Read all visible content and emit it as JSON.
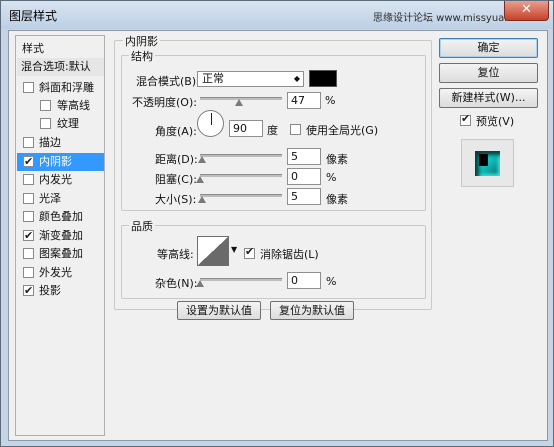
{
  "window": {
    "title": "图层样式",
    "watermark": "思缘设计论坛 www.missyuan.com",
    "close_glyph": "✕"
  },
  "stylelist": {
    "header": "样式",
    "default_item": "混合选项:默认",
    "items": [
      {
        "label": "斜面和浮雕",
        "checked": false
      },
      {
        "label": "等高线",
        "checked": false
      },
      {
        "label": "纹理",
        "checked": false
      },
      {
        "label": "描边",
        "checked": false
      },
      {
        "label": "内阴影",
        "checked": true,
        "selected": true
      },
      {
        "label": "内发光",
        "checked": false
      },
      {
        "label": "光泽",
        "checked": false
      },
      {
        "label": "颜色叠加",
        "checked": false
      },
      {
        "label": "渐变叠加",
        "checked": true
      },
      {
        "label": "图案叠加",
        "checked": false
      },
      {
        "label": "外发光",
        "checked": false
      },
      {
        "label": "投影",
        "checked": true
      }
    ]
  },
  "inner_shadow": {
    "title": "内阴影",
    "structure": {
      "title": "结构",
      "blend_mode_label": "混合模式(B):",
      "blend_mode_value": "正常",
      "blend_color": "#000000",
      "opacity_label": "不透明度(O):",
      "opacity_value": "47",
      "opacity_unit": "%",
      "angle_label": "角度(A):",
      "angle_value": "90",
      "angle_unit": "度",
      "global_light_label": "使用全局光(G)",
      "global_light_checked": false,
      "distance_label": "距离(D):",
      "distance_value": "5",
      "distance_unit": "像素",
      "choke_label": "阻塞(C):",
      "choke_value": "0",
      "choke_unit": "%",
      "size_label": "大小(S):",
      "size_value": "5",
      "size_unit": "像素"
    },
    "quality": {
      "title": "品质",
      "contour_label": "等高线:",
      "antialias_label": "消除锯齿(L)",
      "antialias_checked": true,
      "noise_label": "杂色(N):",
      "noise_value": "0",
      "noise_unit": "%"
    },
    "make_default_label": "设置为默认值",
    "reset_default_label": "复位为默认值"
  },
  "right_panel": {
    "ok_label": "确定",
    "reset_label": "复位",
    "new_style_label": "新建样式(W)...",
    "preview_label": "预览(V)",
    "preview_checked": true
  },
  "slider_levels": {
    "opacity_pct": 47,
    "distance_pct": 2,
    "choke_pct": 0,
    "size_pct": 2,
    "noise_pct": 0
  }
}
